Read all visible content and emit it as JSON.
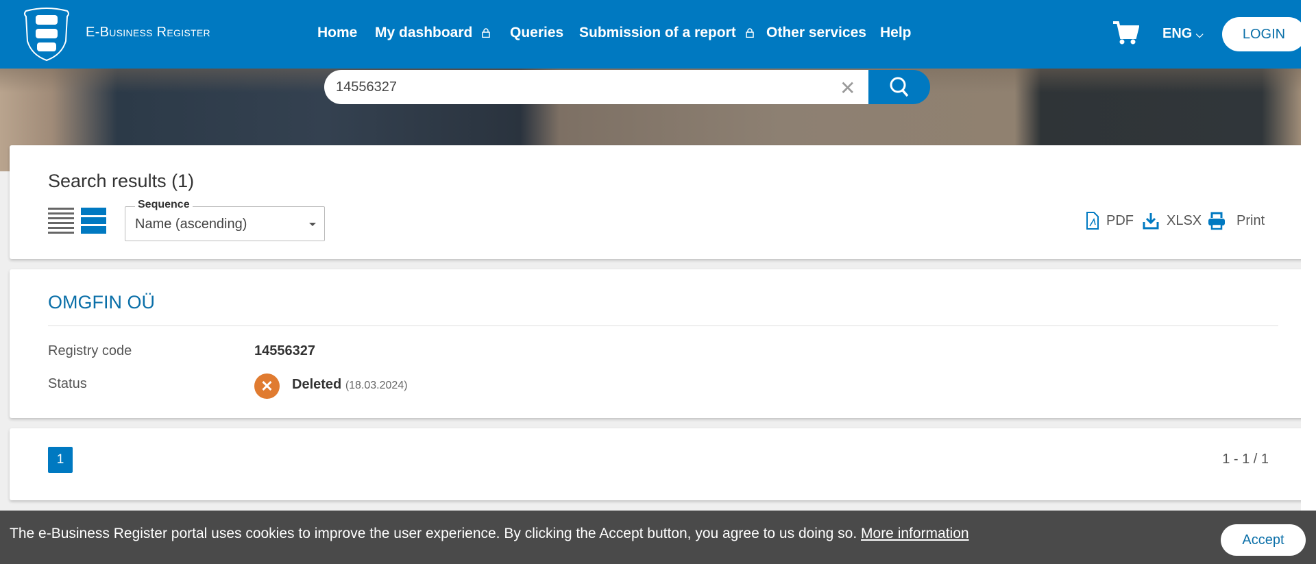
{
  "header": {
    "brand": "E-Business Register",
    "nav": [
      {
        "label": "Home",
        "locked": false
      },
      {
        "label": "My dashboard",
        "locked": true
      },
      {
        "label": "Queries",
        "locked": false
      },
      {
        "label": "Submission of a report",
        "locked": true
      },
      {
        "label": "Other services",
        "locked": false
      },
      {
        "label": "Help",
        "locked": false
      }
    ],
    "language": "ENG",
    "login_label": "LOGIN"
  },
  "search": {
    "value": "14556327"
  },
  "results": {
    "title": "Search results (1)",
    "sort_label": "Sequence",
    "sort_value": "Name (ascending)",
    "exports": {
      "pdf": "PDF",
      "xlsx": "XLSX",
      "print": "Print"
    }
  },
  "company": {
    "name": "OMGFIN OÜ",
    "registry_code_label": "Registry code",
    "registry_code": "14556327",
    "status_label": "Status",
    "status": "Deleted",
    "status_date": "(18.03.2024)",
    "status_color": "#e07b30"
  },
  "pagination": {
    "current_page": "1",
    "range": "1 - 1 / 1"
  },
  "cookie": {
    "text": "The e-Business Register portal uses cookies to improve the user experience. By clicking the Accept button, you agree to us doing so.",
    "more_link": "More information",
    "accept_label": "Accept"
  },
  "colors": {
    "brand": "#0079c1",
    "cookie_bg": "#4a4a4a"
  }
}
